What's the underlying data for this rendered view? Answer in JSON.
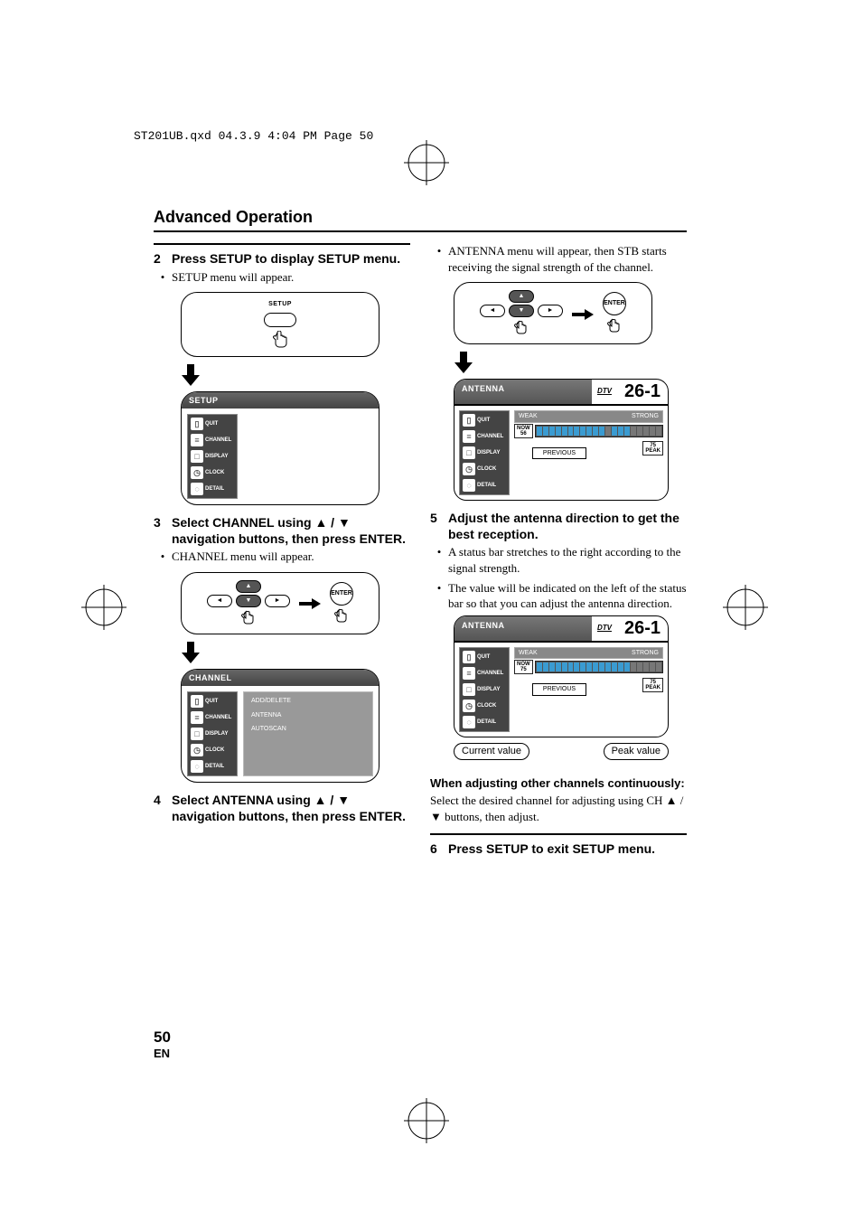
{
  "meta": {
    "filename": "ST201UB.qxd  04.3.9  4:04 PM  Page 50"
  },
  "header": {
    "title": "Advanced Operation"
  },
  "left": {
    "step2": {
      "num": "2",
      "text": "Press SETUP to display SETUP menu."
    },
    "step2_bullet": "SETUP menu will appear.",
    "setup_btn": "SETUP",
    "osd_setup_header": "SETUP",
    "menu_items": {
      "quit": "QUIT",
      "channel": "CHANNEL",
      "display": "DISPLAY",
      "clock": "CLOCK",
      "detail": "DETAIL"
    },
    "step3": {
      "num": "3",
      "text_pre": "Select CHANNEL using ",
      "text_post": " navigation buttons, then press ENTER."
    },
    "step3_bullet": "CHANNEL menu will appear.",
    "enter_btn": "ENTER",
    "osd_channel_header": "CHANNEL",
    "channel_submenu": {
      "add": "ADD/DELETE",
      "antenna": "ANTENNA",
      "autoscan": "AUTOSCAN"
    },
    "step4": {
      "num": "4",
      "text_pre": "Select ANTENNA using ",
      "text_post": " navigation buttons, then press ENTER."
    }
  },
  "right": {
    "intro_bullet": "ANTENNA menu will appear, then STB starts receiving the signal strength of the channel.",
    "enter_btn": "ENTER",
    "antenna_header": "ANTENNA",
    "dtv": "DTV",
    "channel_num": "26-1",
    "weak": "WEAK",
    "strong": "STRONG",
    "now": "NOW",
    "now_val_1": "56",
    "now_val_2": "75",
    "peak": "PEAK",
    "peak_val": "75",
    "previous": "PREVIOUS",
    "step5": {
      "num": "5",
      "text": "Adjust the antenna direction to get the best reception."
    },
    "step5_b1": "A status bar stretches to the right according to the signal strength.",
    "step5_b2": "The value will be indicated on the left of the status bar so that you can adjust the antenna direction.",
    "callout_current": "Current value",
    "callout_peak": "Peak value",
    "subhead": "When adjusting other channels continuously:",
    "subtext_pre": "Select the desired channel for adjusting using CH ",
    "subtext_post": " buttons, then adjust.",
    "step6": {
      "num": "6",
      "text": "Press SETUP to exit SETUP menu."
    }
  },
  "footer": {
    "page": "50",
    "lang": "EN"
  }
}
